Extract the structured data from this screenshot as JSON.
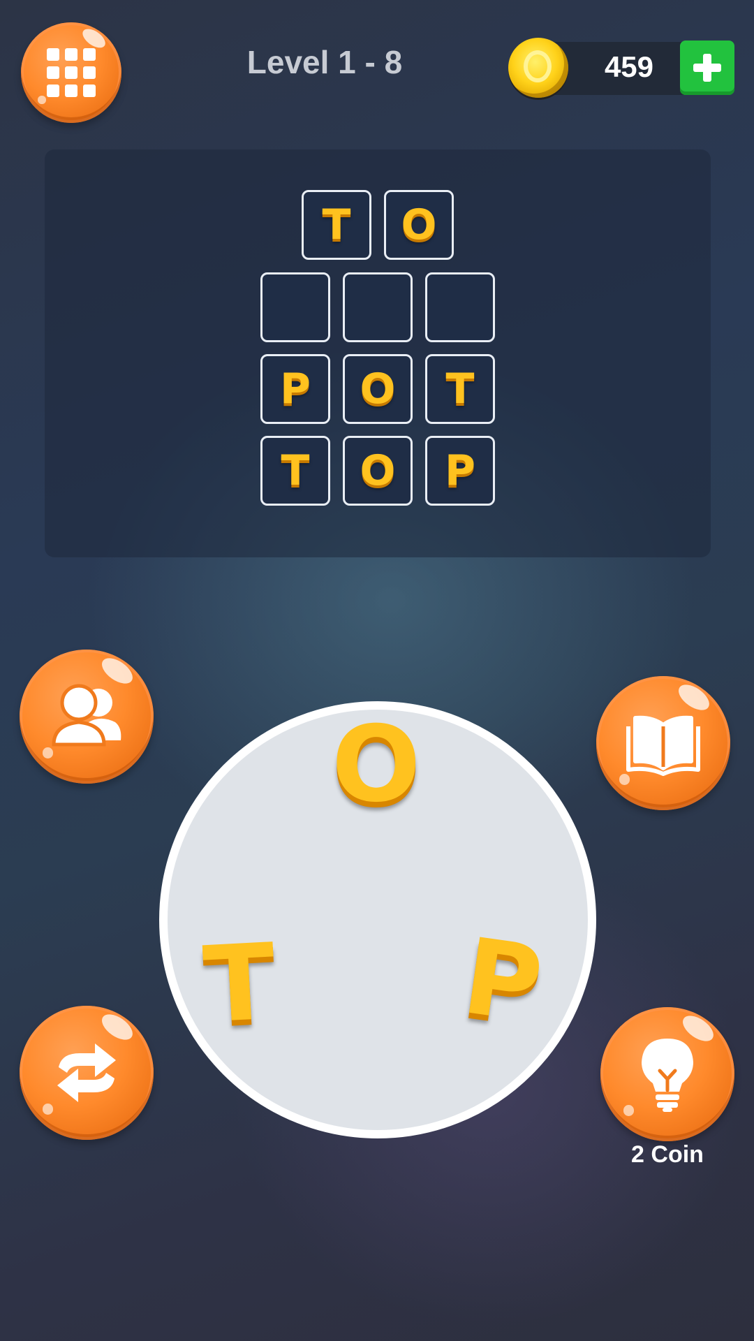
{
  "header": {
    "level_title": "Level 1 - 8",
    "coins": "459"
  },
  "icons": {
    "menu": "grid-icon",
    "coin": "coin-icon",
    "add": "plus-icon",
    "friends": "users-icon",
    "shuffle": "shuffle-icon",
    "dictionary": "book-icon",
    "hint": "lightbulb-icon"
  },
  "colors": {
    "button_orange": "#ff8a2c",
    "letter_yellow": "#ffc21f",
    "add_green": "#22c23e"
  },
  "board": {
    "rows": [
      [
        "T",
        "O"
      ],
      [
        "",
        "",
        ""
      ],
      [
        "P",
        "O",
        "T"
      ],
      [
        "T",
        "O",
        "P"
      ]
    ]
  },
  "wheel": {
    "letters": [
      "O",
      "T",
      "P"
    ]
  },
  "hint": {
    "cost_label": "2 Coin"
  }
}
